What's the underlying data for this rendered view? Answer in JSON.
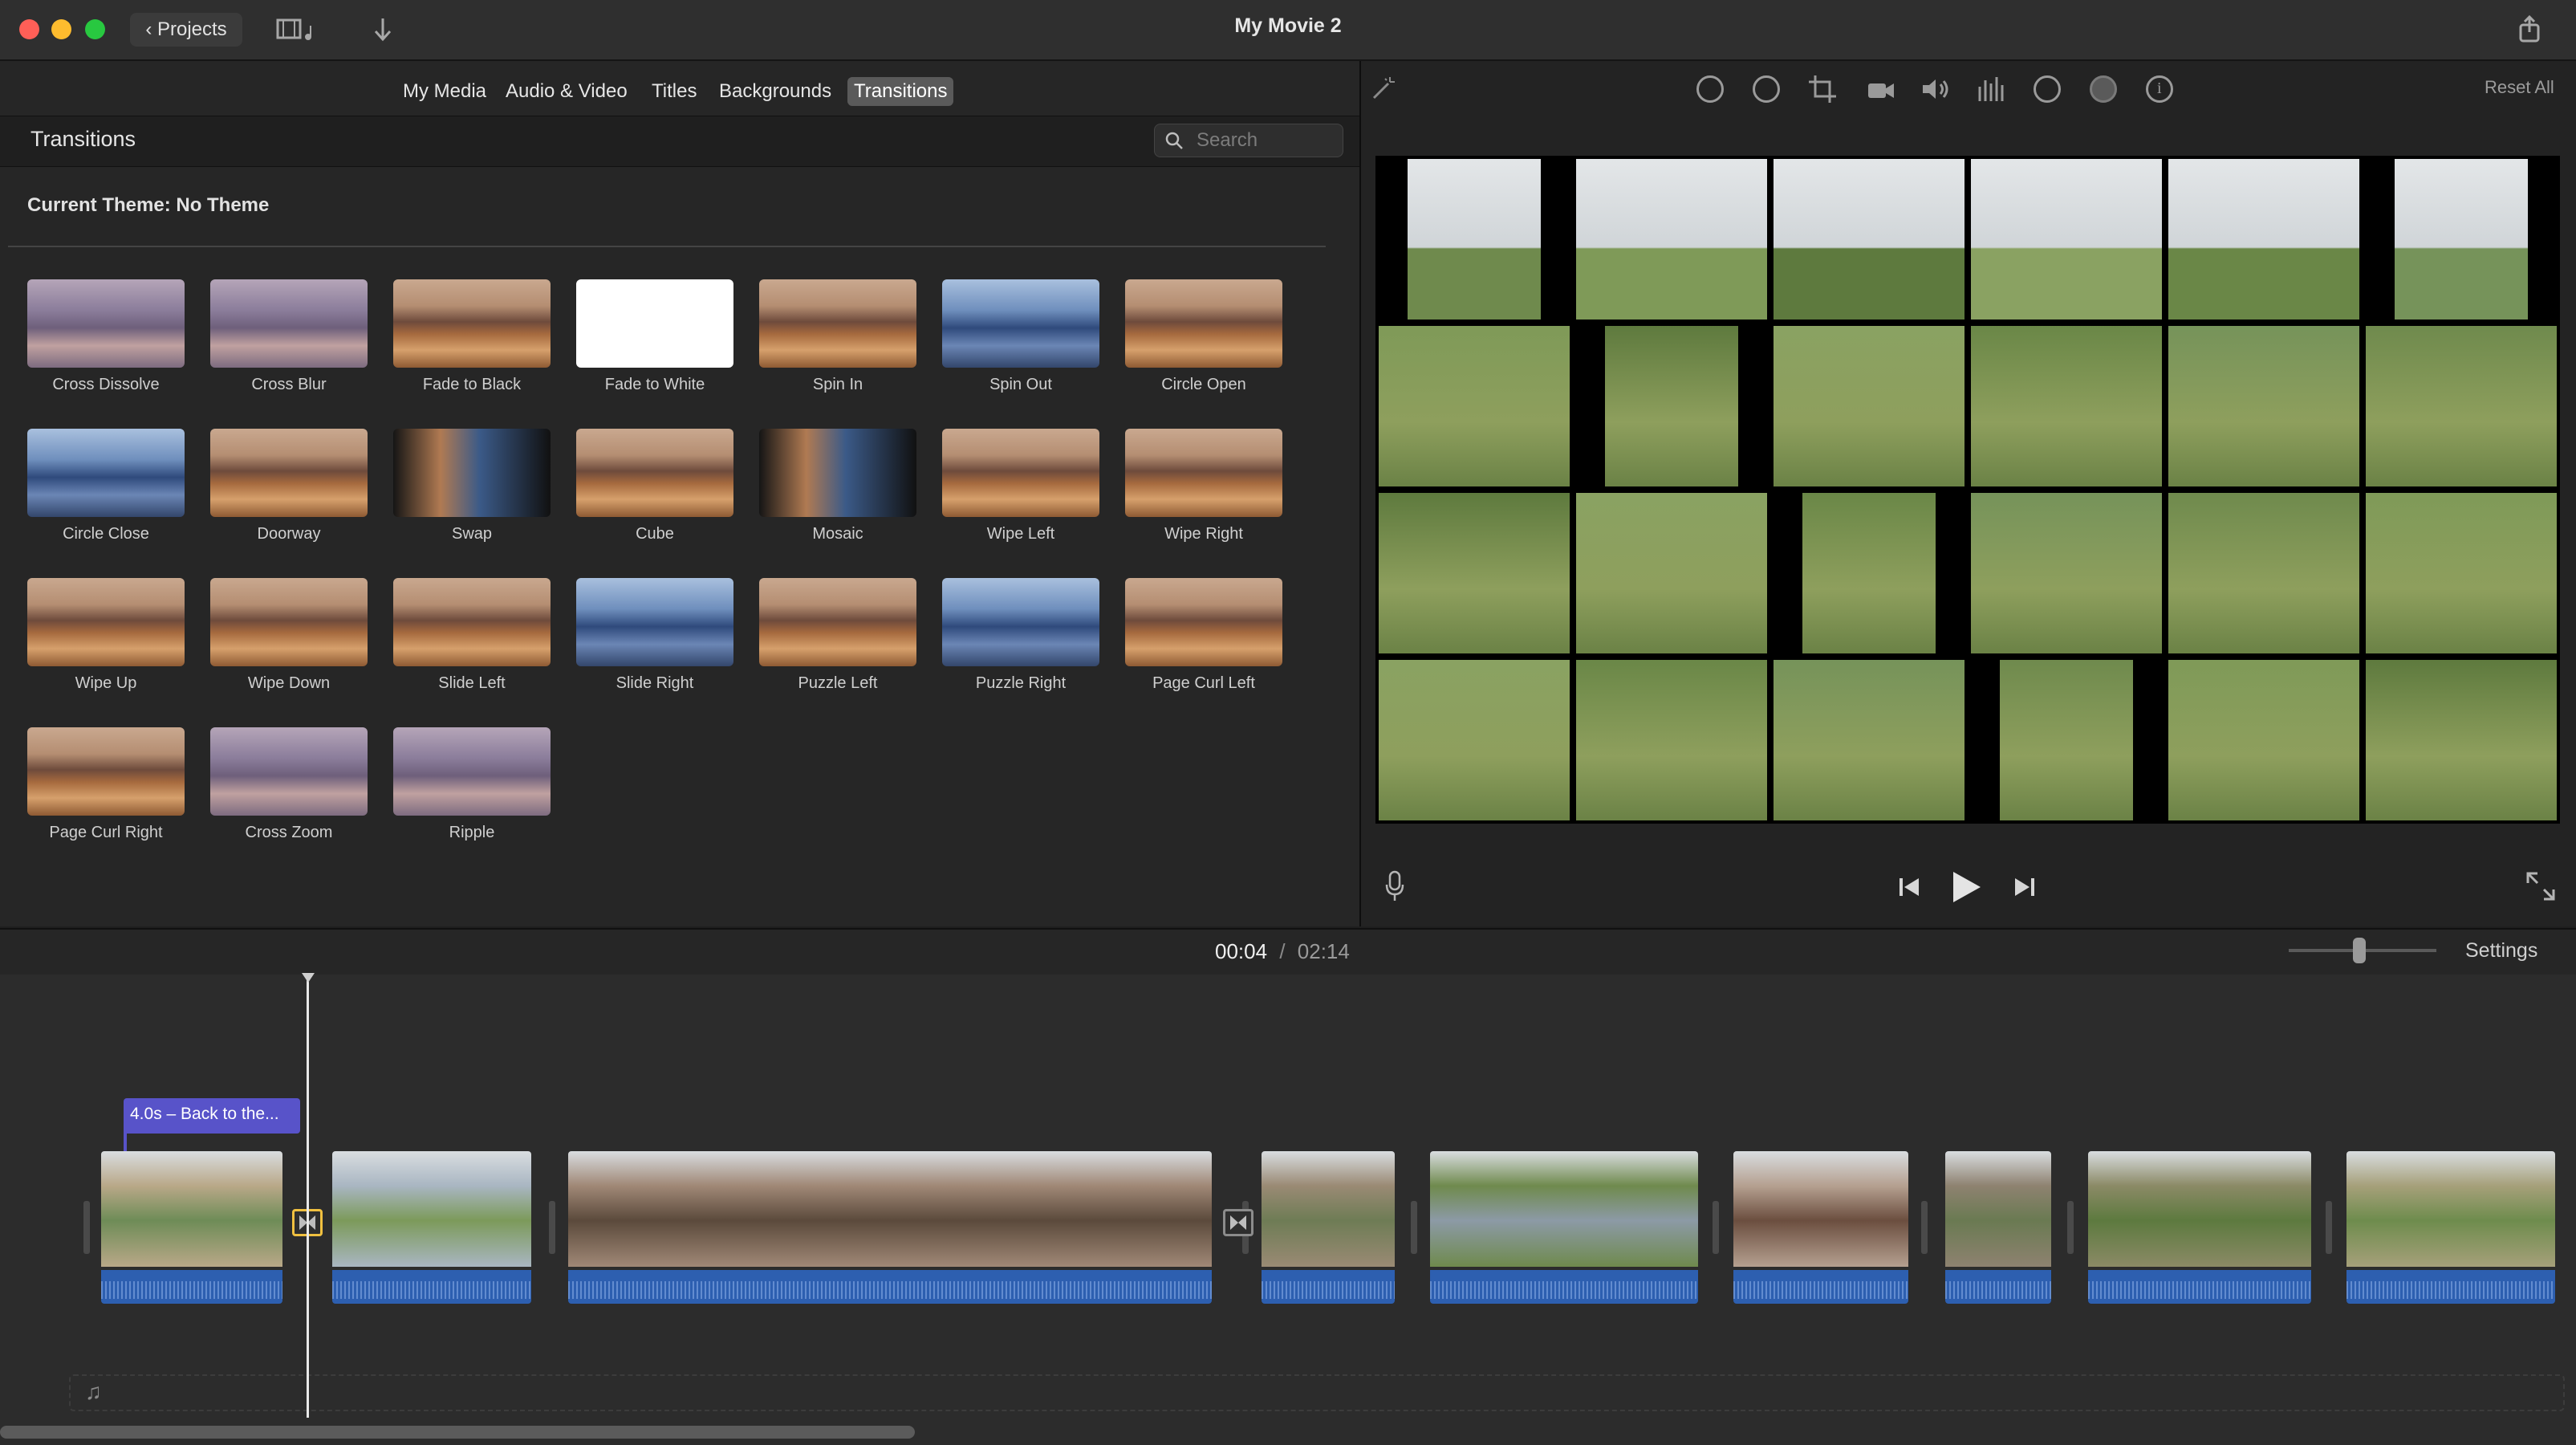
{
  "window": {
    "title": "My Movie 2",
    "projects_label": "Projects",
    "colors": {
      "close": "#ff5f57",
      "minimize": "#febc2e",
      "zoom": "#28c840"
    }
  },
  "browser_tabs": [
    {
      "label": "My Media",
      "active": false
    },
    {
      "label": "Audio & Video",
      "active": false
    },
    {
      "label": "Titles",
      "active": false
    },
    {
      "label": "Backgrounds",
      "active": false
    },
    {
      "label": "Transitions",
      "active": true
    }
  ],
  "section": {
    "title": "Transitions",
    "search_placeholder": "Search",
    "theme_label": "Current Theme: No Theme"
  },
  "transitions": [
    {
      "label": "Cross Dissolve",
      "style": "haze"
    },
    {
      "label": "Cross Blur",
      "style": "haze"
    },
    {
      "label": "Fade to Black",
      "style": "mtn"
    },
    {
      "label": "Fade to White",
      "style": "white"
    },
    {
      "label": "Spin In",
      "style": "mtn"
    },
    {
      "label": "Spin Out",
      "style": "blue"
    },
    {
      "label": "Circle Open",
      "style": "mtn"
    },
    {
      "label": "Circle Close",
      "style": "blue"
    },
    {
      "label": "Doorway",
      "style": "mtn"
    },
    {
      "label": "Swap",
      "style": "dark"
    },
    {
      "label": "Cube",
      "style": "mtn"
    },
    {
      "label": "Mosaic",
      "style": "dark"
    },
    {
      "label": "Wipe Left",
      "style": "mtn"
    },
    {
      "label": "Wipe Right",
      "style": "mtn"
    },
    {
      "label": "Wipe Up",
      "style": "mtn"
    },
    {
      "label": "Wipe Down",
      "style": "mtn"
    },
    {
      "label": "Slide Left",
      "style": "mtn"
    },
    {
      "label": "Slide Right",
      "style": "blue"
    },
    {
      "label": "Puzzle Left",
      "style": "mtn"
    },
    {
      "label": "Puzzle Right",
      "style": "blue"
    },
    {
      "label": "Page Curl Left",
      "style": "mtn"
    },
    {
      "label": "Page Curl Right",
      "style": "mtn"
    },
    {
      "label": "Cross Zoom",
      "style": "haze"
    },
    {
      "label": "Ripple",
      "style": "haze"
    }
  ],
  "viewer": {
    "reset_label": "Reset All",
    "tools": [
      "color-balance-icon",
      "color-correction-icon",
      "crop-icon",
      "stabilization-icon",
      "volume-icon",
      "noise-reduction-icon",
      "speed-icon",
      "clip-filter-icon",
      "info-icon"
    ]
  },
  "timeline": {
    "current_time": "00:04",
    "separator": "/",
    "total_time": "02:14",
    "settings_label": "Settings",
    "title_clip_label": "4.0s – Back to the..."
  }
}
